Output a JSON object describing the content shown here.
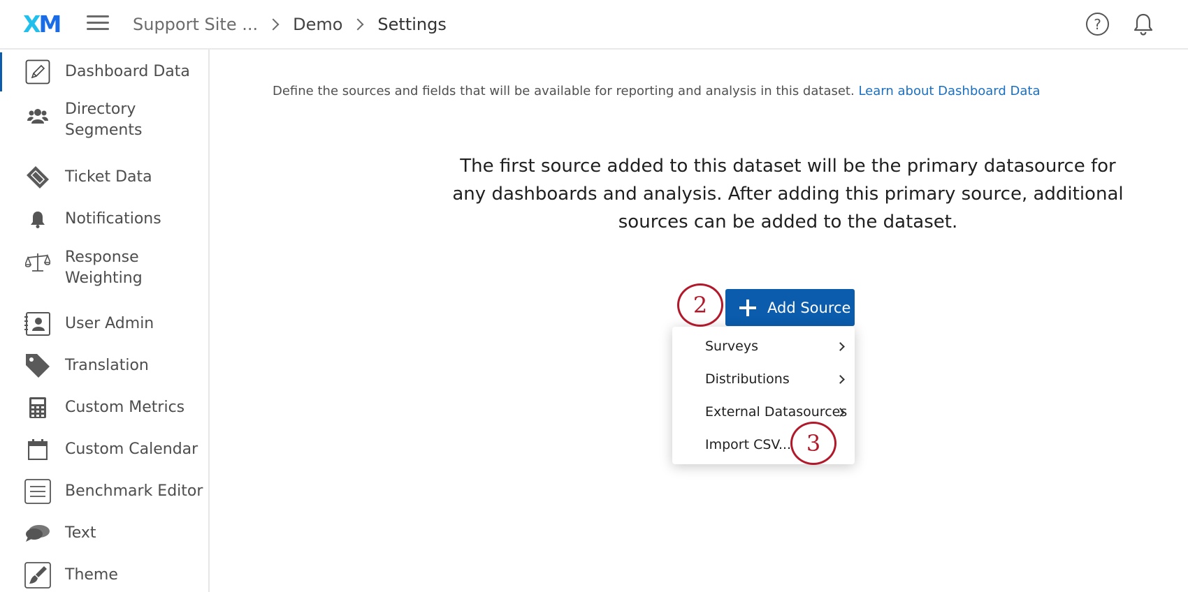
{
  "header": {
    "logo_x": "X",
    "logo_m": "M",
    "breadcrumb": [
      "Support Site ...",
      "Demo",
      "Settings"
    ],
    "help_label": "?"
  },
  "sidebar": {
    "items": [
      {
        "label": "Dashboard Data",
        "icon": "pencil-icon",
        "active": true
      },
      {
        "label": "Directory Segments",
        "icon": "people-icon"
      },
      {
        "label": "Ticket Data",
        "icon": "ticket-icon"
      },
      {
        "label": "Notifications",
        "icon": "bell-icon"
      },
      {
        "label": "Response Weighting",
        "icon": "scale-icon"
      },
      {
        "label": "User Admin",
        "icon": "user-card-icon"
      },
      {
        "label": "Translation",
        "icon": "tag-icon"
      },
      {
        "label": "Custom Metrics",
        "icon": "calculator-icon"
      },
      {
        "label": "Custom Calendar",
        "icon": "calendar-icon"
      },
      {
        "label": "Benchmark Editor",
        "icon": "list-icon"
      },
      {
        "label": "Text",
        "icon": "chat-bubbles-icon"
      },
      {
        "label": "Theme",
        "icon": "paintbrush-icon"
      }
    ]
  },
  "main": {
    "intro_text": "Define the sources and fields that will be available for reporting and analysis in this dataset.",
    "intro_link": "Learn about Dashboard Data",
    "primary_text": "The first source added to this dataset will be the primary datasource for any dashboards and analysis. After adding this primary source, additional sources can be added to the dataset.",
    "add_source_label": "Add Source",
    "menu": [
      {
        "label": "Surveys",
        "has_submenu": true
      },
      {
        "label": "Distributions",
        "has_submenu": true
      },
      {
        "label": "External Datasources",
        "has_submenu": true
      },
      {
        "label": "Import CSV...",
        "has_submenu": false
      }
    ]
  },
  "annotations": {
    "step_2": "2",
    "step_3": "3",
    "color": "#b1192b"
  },
  "colors": {
    "accent": "#0b5cad",
    "link": "#1a6fc1"
  }
}
